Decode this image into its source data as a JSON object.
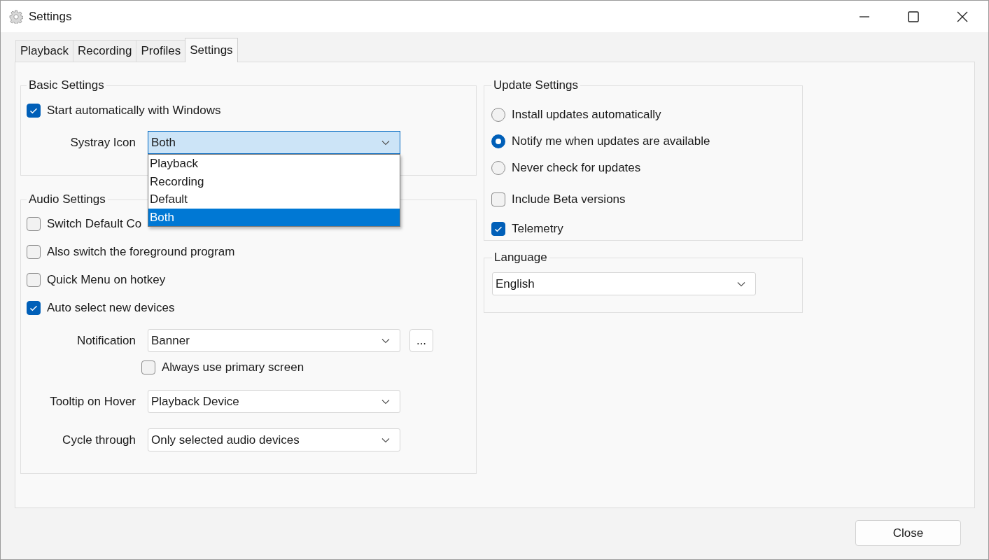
{
  "window": {
    "title": "Settings"
  },
  "tabs": [
    {
      "label": "Playback",
      "selected": false
    },
    {
      "label": "Recording",
      "selected": false
    },
    {
      "label": "Profiles",
      "selected": false
    },
    {
      "label": "Settings",
      "selected": true
    }
  ],
  "basic_settings": {
    "title": "Basic Settings",
    "start_with_windows": {
      "label": "Start automatically with Windows",
      "checked": true
    },
    "systray_icon": {
      "label": "Systray Icon",
      "value": "Both",
      "expanded": true,
      "options": [
        {
          "label": "Playback",
          "selected": false
        },
        {
          "label": "Recording",
          "selected": false
        },
        {
          "label": "Default",
          "selected": false
        },
        {
          "label": "Both",
          "selected": true
        }
      ]
    }
  },
  "audio_settings": {
    "title": "Audio Settings",
    "checkboxes": [
      {
        "label": "Switch Default Co",
        "checked": false
      },
      {
        "label": "Also switch the foreground program",
        "checked": false
      },
      {
        "label": "Quick Menu on hotkey",
        "checked": false
      },
      {
        "label": "Auto select new devices",
        "checked": true
      }
    ],
    "notification": {
      "label": "Notification",
      "value": "Banner",
      "more_button": "..."
    },
    "always_primary_screen": {
      "label": "Always use primary screen",
      "checked": false
    },
    "tooltip": {
      "label": "Tooltip on Hover",
      "value": "Playback Device"
    },
    "cycle": {
      "label": "Cycle through",
      "value": "Only selected audio devices"
    }
  },
  "update_settings": {
    "title": "Update Settings",
    "options": [
      {
        "label": "Install updates automatically",
        "selected": false
      },
      {
        "label": "Notify me when updates are available",
        "selected": true
      },
      {
        "label": "Never check for updates",
        "selected": false
      }
    ],
    "checkboxes": [
      {
        "label": "Include Beta versions",
        "checked": false
      },
      {
        "label": "Telemetry",
        "checked": true
      }
    ]
  },
  "language": {
    "title": "Language",
    "value": "English"
  },
  "close_button": "Close"
}
